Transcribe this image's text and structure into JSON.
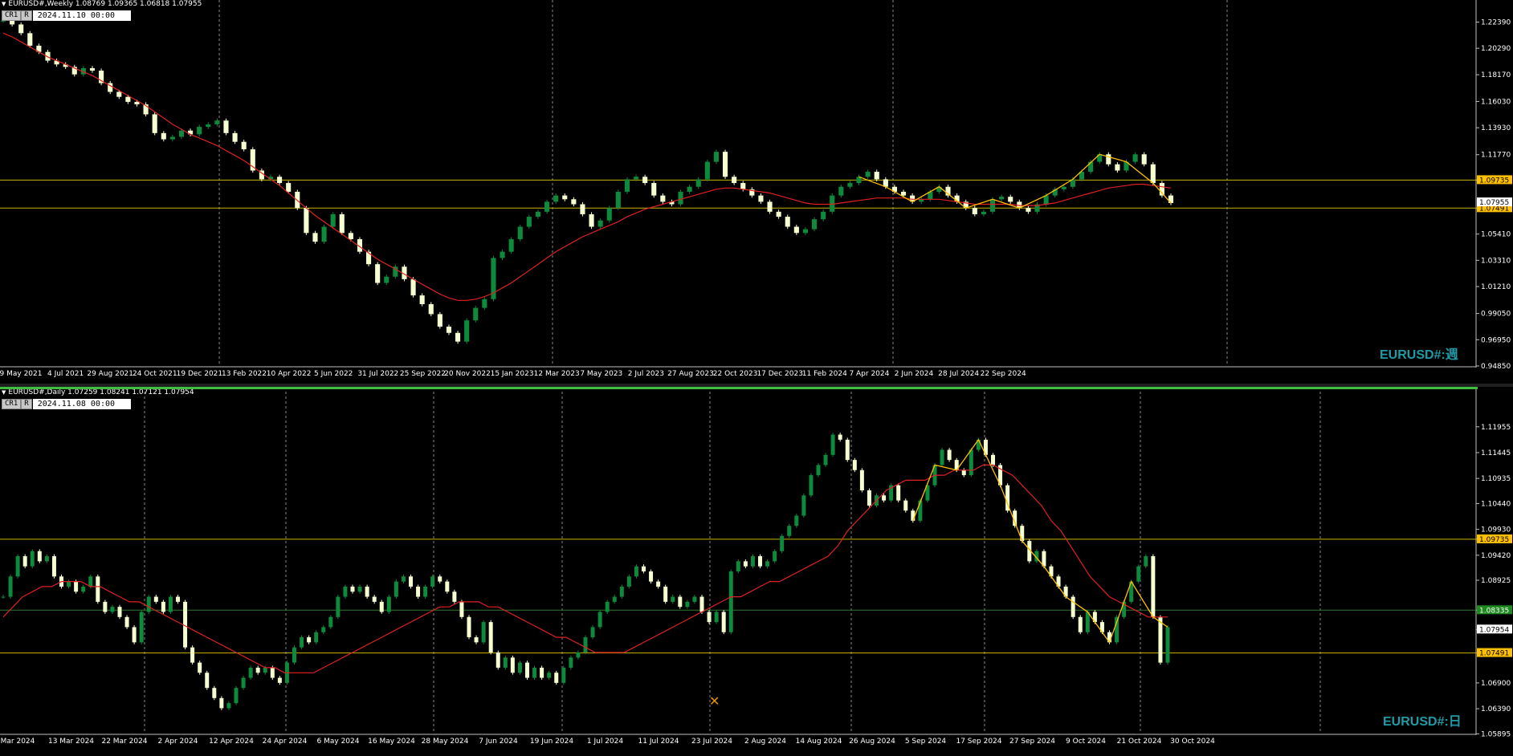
{
  "colors": {
    "background": "#000000",
    "bull_candle": "#0e8a3c",
    "bear_candle": "#f5ffcf",
    "ma_line": "#e02020",
    "zigzag": "#ffc000",
    "level_line": "#c8b400",
    "current_level": "#2a7a2a",
    "grid": "#c0c0c0",
    "symbol_label": "#1f9aa6"
  },
  "top_chart": {
    "header": "EURUSD#,Weekly  1.08769 1.09365 1.06818 1.07955",
    "ctrl_a": "CR1",
    "ctrl_b": "R",
    "date_box": "2024.11.10 00:00",
    "symbol_label": "EURUSD#:週",
    "level_labels": [
      "1.09735",
      "1.07491"
    ],
    "current_price_label": "1.07955"
  },
  "bottom_chart": {
    "header": "EURUSD#,Daily  1.07259 1.08241 1.07121 1.07954",
    "ctrl_a": "CR1",
    "ctrl_b": "R",
    "date_box": "2024.11.08 00:00",
    "symbol_label": "EURUSD#:日",
    "level_labels": [
      "1.09735",
      "1.07491"
    ],
    "current_price_label": "1.07954",
    "green_line_label": "1.08335"
  },
  "chart_data": [
    {
      "type": "candlestick",
      "timeframe": "Weekly",
      "ohlc_last": {
        "open": 1.08769,
        "high": 1.09365,
        "low": 1.06818,
        "close": 1.07955
      },
      "y_ticks": [
        "1.22390",
        "1.20290",
        "1.18170",
        "1.16030",
        "1.13930",
        "1.11770",
        "1.09735",
        "1.07491",
        "1.05410",
        "1.03310",
        "1.01210",
        "0.99050",
        "0.96950",
        "0.94850"
      ],
      "ylim": [
        0.9485,
        1.23
      ],
      "x_ticks": [
        "9 May 2021",
        "4 Jul 2021",
        "29 Aug 2021",
        "24 Oct 2021",
        "19 Dec 2021",
        "13 Feb 2022",
        "10 Apr 2022",
        "5 Jun 2022",
        "31 Jul 2022",
        "25 Sep 2022",
        "20 Nov 2022",
        "15 Jan 2023",
        "12 Mar 2023",
        "7 May 2023",
        "2 Jul 2023",
        "27 Aug 2023",
        "22 Oct 2023",
        "17 Dec 2023",
        "11 Feb 2024",
        "7 Apr 2024",
        "2 Jun 2024",
        "28 Jul 2024",
        "22 Sep 2024"
      ],
      "horizontal_levels": [
        1.09735,
        1.07491
      ],
      "close_path": [
        1.225,
        1.222,
        1.215,
        1.205,
        1.2,
        1.193,
        1.19,
        1.188,
        1.182,
        1.187,
        1.185,
        1.175,
        1.168,
        1.164,
        1.16,
        1.158,
        1.15,
        1.135,
        1.13,
        1.132,
        1.137,
        1.134,
        1.14,
        1.142,
        1.145,
        1.135,
        1.128,
        1.122,
        1.105,
        1.098,
        1.1,
        1.095,
        1.088,
        1.075,
        1.055,
        1.048,
        1.06,
        1.07,
        1.055,
        1.05,
        1.04,
        1.03,
        1.015,
        1.02,
        1.028,
        1.018,
        1.005,
        0.998,
        0.99,
        0.98,
        0.975,
        0.968,
        0.985,
        0.995,
        1.002,
        1.035,
        1.04,
        1.05,
        1.06,
        1.068,
        1.072,
        1.08,
        1.085,
        1.082,
        1.078,
        1.07,
        1.06,
        1.065,
        1.075,
        1.088,
        1.098,
        1.1,
        1.095,
        1.085,
        1.08,
        1.078,
        1.088,
        1.092,
        1.098,
        1.112,
        1.12,
        1.1,
        1.095,
        1.09,
        1.085,
        1.08,
        1.072,
        1.068,
        1.06,
        1.055,
        1.058,
        1.066,
        1.072,
        1.085,
        1.092,
        1.095,
        1.1,
        1.104,
        1.098,
        1.092,
        1.088,
        1.085,
        1.08,
        1.082,
        1.088,
        1.092,
        1.085,
        1.08,
        1.075,
        1.07,
        1.072,
        1.082,
        1.084,
        1.08,
        1.075,
        1.072,
        1.078,
        1.085,
        1.09,
        1.092,
        1.098,
        1.104,
        1.112,
        1.118,
        1.11,
        1.105,
        1.112,
        1.118,
        1.11,
        1.095,
        1.085,
        1.079
      ],
      "ma_period_note": "",
      "series": [
        {
          "role": "ma",
          "values": [
            1.215,
            1.212,
            1.208,
            1.204,
            1.2,
            1.196,
            1.193,
            1.19,
            1.187,
            1.184,
            1.181,
            1.177,
            1.173,
            1.169,
            1.165,
            1.161,
            1.157,
            1.152,
            1.147,
            1.142,
            1.138,
            1.134,
            1.131,
            1.128,
            1.125,
            1.121,
            1.117,
            1.113,
            1.108,
            1.103,
            1.098,
            1.093,
            1.087,
            1.081,
            1.075,
            1.069,
            1.064,
            1.059,
            1.054,
            1.049,
            1.044,
            1.039,
            1.034,
            1.03,
            1.026,
            1.022,
            1.018,
            1.014,
            1.01,
            1.006,
            1.003,
            1.001,
            1.001,
            1.002,
            1.004,
            1.007,
            1.011,
            1.015,
            1.02,
            1.025,
            1.03,
            1.035,
            1.04,
            1.044,
            1.048,
            1.052,
            1.055,
            1.058,
            1.061,
            1.064,
            1.068,
            1.071,
            1.074,
            1.076,
            1.078,
            1.08,
            1.082,
            1.084,
            1.086,
            1.088,
            1.09,
            1.091,
            1.091,
            1.09,
            1.089,
            1.088,
            1.087,
            1.085,
            1.083,
            1.081,
            1.079,
            1.078,
            1.078,
            1.078,
            1.079,
            1.08,
            1.081,
            1.082,
            1.083,
            1.083,
            1.083,
            1.083,
            1.082,
            1.082,
            1.082,
            1.082,
            1.081,
            1.08,
            1.079,
            1.078,
            1.078,
            1.078,
            1.078,
            1.078,
            1.077,
            1.077,
            1.077,
            1.078,
            1.079,
            1.081,
            1.083,
            1.085,
            1.087,
            1.089,
            1.091,
            1.092,
            1.093,
            1.094,
            1.094,
            1.093,
            1.092,
            1.091
          ]
        }
      ]
    },
    {
      "type": "candlestick",
      "timeframe": "Daily",
      "ohlc_last": {
        "open": 1.07259,
        "high": 1.08241,
        "low": 1.07121,
        "close": 1.07954
      },
      "y_ticks": [
        "1.11955",
        "1.11445",
        "1.10935",
        "1.10440",
        "1.09930",
        "1.09735",
        "1.09420",
        "1.08925",
        "1.08335",
        "1.07954",
        "1.07491",
        "1.06900",
        "1.06390",
        "1.05895"
      ],
      "ylim": [
        1.059,
        1.123
      ],
      "x_ticks": [
        "Mar 2024",
        "13 Mar 2024",
        "22 Mar 2024",
        "2 Apr 2024",
        "12 Apr 2024",
        "24 Apr 2024",
        "6 May 2024",
        "16 May 2024",
        "28 May 2024",
        "7 Jun 2024",
        "19 Jun 2024",
        "1 Jul 2024",
        "11 Jul 2024",
        "23 Jul 2024",
        "2 Aug 2024",
        "14 Aug 2024",
        "26 Aug 2024",
        "5 Sep 2024",
        "17 Sep 2024",
        "27 Sep 2024",
        "9 Oct 2024",
        "21 Oct 2024",
        "30 Oct 2024"
      ],
      "horizontal_levels": [
        1.09735,
        1.07491,
        1.08335
      ],
      "close_path": [
        1.086,
        1.09,
        1.094,
        1.092,
        1.095,
        1.093,
        1.094,
        1.09,
        1.088,
        1.089,
        1.087,
        1.088,
        1.09,
        1.085,
        1.083,
        1.084,
        1.082,
        1.08,
        1.077,
        1.083,
        1.086,
        1.085,
        1.083,
        1.086,
        1.085,
        1.076,
        1.073,
        1.071,
        1.068,
        1.066,
        1.064,
        1.065,
        1.068,
        1.07,
        1.072,
        1.071,
        1.072,
        1.07,
        1.069,
        1.073,
        1.076,
        1.078,
        1.077,
        1.079,
        1.08,
        1.082,
        1.086,
        1.088,
        1.087,
        1.088,
        1.086,
        1.085,
        1.083,
        1.086,
        1.089,
        1.09,
        1.088,
        1.086,
        1.088,
        1.09,
        1.089,
        1.087,
        1.085,
        1.082,
        1.078,
        1.077,
        1.081,
        1.075,
        1.072,
        1.074,
        1.071,
        1.073,
        1.07,
        1.072,
        1.07,
        1.071,
        1.069,
        1.072,
        1.074,
        1.075,
        1.078,
        1.08,
        1.083,
        1.085,
        1.086,
        1.088,
        1.09,
        1.092,
        1.091,
        1.089,
        1.088,
        1.085,
        1.086,
        1.084,
        1.085,
        1.086,
        1.083,
        1.081,
        1.083,
        1.079,
        1.091,
        1.093,
        1.092,
        1.094,
        1.092,
        1.093,
        1.095,
        1.098,
        1.1,
        1.102,
        1.106,
        1.11,
        1.112,
        1.114,
        1.118,
        1.117,
        1.113,
        1.111,
        1.107,
        1.104,
        1.106,
        1.105,
        1.108,
        1.105,
        1.103,
        1.101,
        1.105,
        1.108,
        1.112,
        1.115,
        1.113,
        1.111,
        1.11,
        1.115,
        1.117,
        1.114,
        1.112,
        1.108,
        1.103,
        1.1,
        1.097,
        1.093,
        1.095,
        1.092,
        1.09,
        1.088,
        1.086,
        1.082,
        1.079,
        1.083,
        1.081,
        1.079,
        1.077,
        1.082,
        1.085,
        1.089,
        1.092,
        1.094,
        1.082,
        1.073,
        1.08
      ],
      "series": [
        {
          "role": "ma",
          "values": [
            1.082,
            1.084,
            1.086,
            1.087,
            1.088,
            1.088,
            1.089,
            1.089,
            1.089,
            1.088,
            1.088,
            1.087,
            1.086,
            1.085,
            1.085,
            1.084,
            1.083,
            1.082,
            1.081,
            1.08,
            1.079,
            1.078,
            1.077,
            1.076,
            1.075,
            1.074,
            1.073,
            1.072,
            1.072,
            1.071,
            1.071,
            1.071,
            1.071,
            1.072,
            1.073,
            1.074,
            1.075,
            1.076,
            1.077,
            1.078,
            1.079,
            1.08,
            1.081,
            1.082,
            1.083,
            1.084,
            1.084,
            1.085,
            1.085,
            1.085,
            1.084,
            1.084,
            1.083,
            1.082,
            1.081,
            1.08,
            1.079,
            1.078,
            1.078,
            1.077,
            1.076,
            1.075,
            1.075,
            1.075,
            1.075,
            1.076,
            1.077,
            1.078,
            1.079,
            1.08,
            1.081,
            1.082,
            1.083,
            1.084,
            1.085,
            1.086,
            1.086,
            1.087,
            1.088,
            1.089,
            1.089,
            1.09,
            1.091,
            1.092,
            1.093,
            1.094,
            1.096,
            1.099,
            1.101,
            1.103,
            1.105,
            1.107,
            1.108,
            1.109,
            1.109,
            1.109,
            1.11,
            1.11,
            1.111,
            1.111,
            1.111,
            1.112,
            1.112,
            1.111,
            1.11,
            1.108,
            1.106,
            1.104,
            1.101,
            1.099,
            1.096,
            1.093,
            1.09,
            1.088,
            1.086,
            1.085,
            1.084,
            1.083,
            1.082,
            1.082,
            1.082
          ]
        }
      ]
    }
  ]
}
